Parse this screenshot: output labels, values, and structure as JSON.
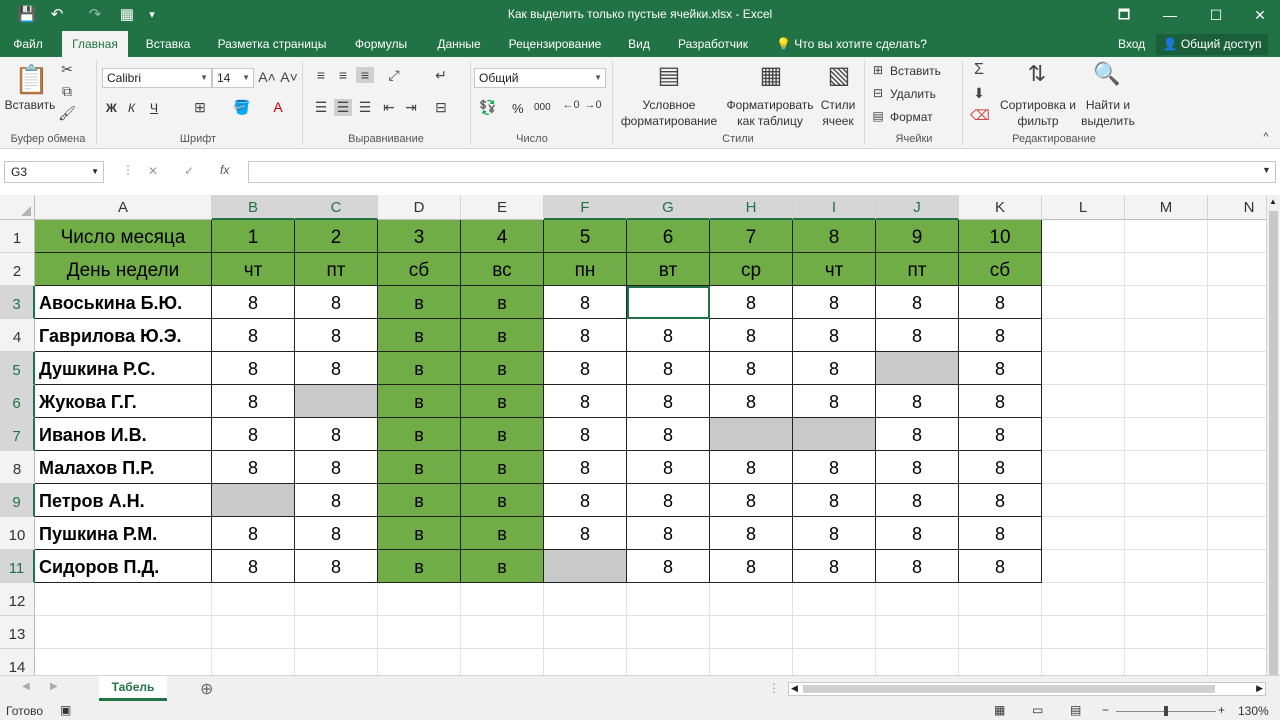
{
  "title": "Как выделить только пустые ячейки.xlsx - Excel",
  "window_controls": {
    "ribbon_options": "🗖",
    "minimize": "—",
    "maximize": "☐",
    "close": "✕"
  },
  "quick_access": {
    "save": "💾",
    "undo": "↶",
    "redo": "↷",
    "form": "▦",
    "customize": "▾"
  },
  "tabs": [
    "Файл",
    "Главная",
    "Вставка",
    "Разметка страницы",
    "Формулы",
    "Данные",
    "Рецензирование",
    "Вид",
    "Разработчик"
  ],
  "tell_me": "Что вы хотите сделать?",
  "login": "Вход",
  "share": "Общий доступ",
  "ribbon": {
    "clipboard": {
      "label": "Буфер обмена",
      "paste": "Вставить"
    },
    "font": {
      "label": "Шрифт",
      "name": "Calibri",
      "size": "14",
      "bold": "Ж",
      "italic": "К",
      "underline": "Ч"
    },
    "alignment": {
      "label": "Выравнивание"
    },
    "number": {
      "label": "Число",
      "format": "Общий",
      "percent": "%",
      "thousands": "000"
    },
    "styles": {
      "label": "Стили",
      "conditional": "Условное форматирование",
      "as_table": "Форматировать как таблицу",
      "cell_styles": "Стили ячеек"
    },
    "cells": {
      "label": "Ячейки",
      "insert": "Вставить",
      "delete": "Удалить",
      "format": "Формат"
    },
    "editing": {
      "label": "Редактирование",
      "sort": "Сортировка и фильтр",
      "find": "Найти и выделить"
    }
  },
  "formula_bar": {
    "name_box": "G3",
    "fx": "fx",
    "cancel": "✕",
    "enter": "✓",
    "value": ""
  },
  "columns": [
    "A",
    "B",
    "C",
    "D",
    "E",
    "F",
    "G",
    "H",
    "I",
    "J",
    "K",
    "L",
    "M",
    "N"
  ],
  "rows": [
    "1",
    "2",
    "3",
    "4",
    "5",
    "6",
    "7",
    "8",
    "9",
    "10",
    "11",
    "12",
    "13",
    "14"
  ],
  "sheet": {
    "row1": [
      "Число месяца",
      "1",
      "2",
      "3",
      "4",
      "5",
      "6",
      "7",
      "8",
      "9",
      "10"
    ],
    "row2": [
      "День недели",
      "чт",
      "пт",
      "сб",
      "вс",
      "пн",
      "вт",
      "ср",
      "чт",
      "пт",
      "сб"
    ],
    "data": [
      [
        "Авоськина Б.Ю.",
        "8",
        "8",
        "в",
        "в",
        "8",
        "",
        "8",
        "8",
        "8",
        "8"
      ],
      [
        "Гаврилова Ю.Э.",
        "8",
        "8",
        "в",
        "в",
        "8",
        "8",
        "8",
        "8",
        "8",
        "8"
      ],
      [
        "Душкина Р.С.",
        "8",
        "8",
        "в",
        "в",
        "8",
        "8",
        "8",
        "8",
        "",
        "8"
      ],
      [
        "Жукова Г.Г.",
        "8",
        "",
        "в",
        "в",
        "8",
        "8",
        "8",
        "8",
        "8",
        "8"
      ],
      [
        "Иванов И.В.",
        "8",
        "8",
        "в",
        "в",
        "8",
        "8",
        "",
        "",
        "8",
        "8"
      ],
      [
        "Малахов П.Р.",
        "8",
        "8",
        "в",
        "в",
        "8",
        "8",
        "8",
        "8",
        "8",
        "8"
      ],
      [
        "Петров А.Н.",
        "",
        "8",
        "в",
        "в",
        "8",
        "8",
        "8",
        "8",
        "8",
        "8"
      ],
      [
        "Пушкина Р.М.",
        "8",
        "8",
        "в",
        "в",
        "8",
        "8",
        "8",
        "8",
        "8",
        "8"
      ],
      [
        "Сидоров П.Д.",
        "8",
        "8",
        "в",
        "в",
        "",
        "8",
        "8",
        "8",
        "8",
        "8"
      ]
    ],
    "header_fill": "#70ad47",
    "empty_fill": "#c9c9c9"
  },
  "sheet_tab": "Табель",
  "status": {
    "ready": "Готово",
    "zoom": "130%"
  }
}
